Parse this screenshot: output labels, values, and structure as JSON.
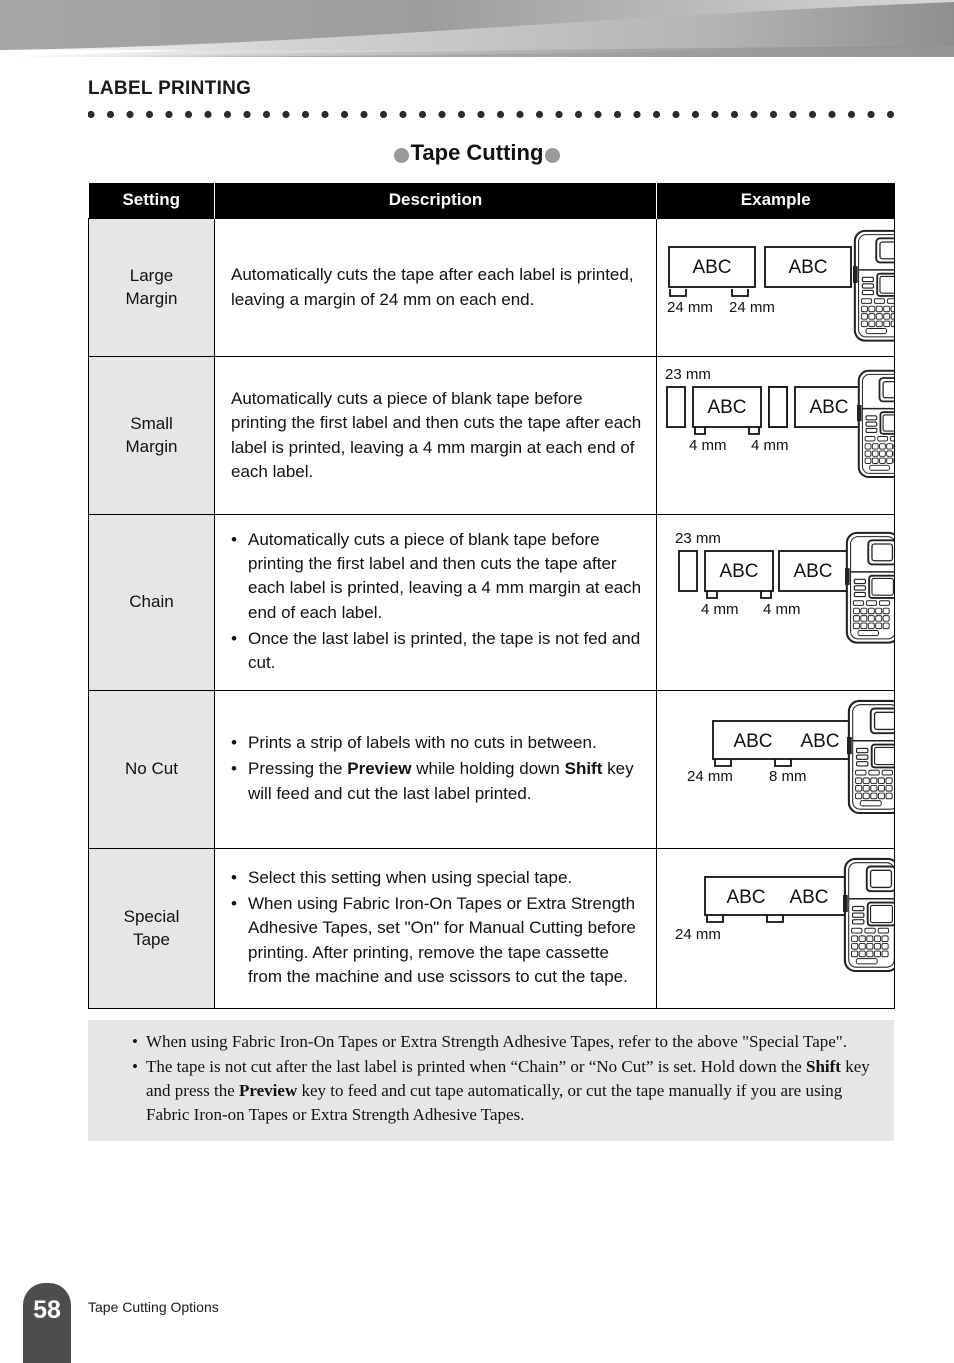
{
  "header": {
    "chapter": "LABEL PRINTING",
    "section_title": "Tape Cutting"
  },
  "table": {
    "columns": [
      "Setting",
      "Description",
      "Example"
    ],
    "rows": [
      {
        "setting": "Large\nMargin",
        "description_type": "paragraph",
        "description": "Automatically cuts the tape after each label is printed, leaving a margin of 24 mm on each end.",
        "example": {
          "style": "two-separate-labels",
          "labels": [
            "ABC",
            "ABC"
          ],
          "measures": [
            "24 mm",
            "24 mm"
          ],
          "lead_measure": ""
        }
      },
      {
        "setting": "Small\nMargin",
        "description_type": "paragraph",
        "description": "Automatically cuts a piece of blank tape before printing the first label and then cuts the tape after each label is printed, leaving a 4 mm margin at each end of each label.",
        "example": {
          "style": "blank-plus-two-labels",
          "labels": [
            "ABC",
            "ABC"
          ],
          "measures": [
            "4 mm",
            "4 mm"
          ],
          "lead_measure": "23 mm"
        }
      },
      {
        "setting": "Chain",
        "description_type": "bullets",
        "bullets": [
          "Automatically cuts a piece of blank tape before printing the first label and then cuts the tape after each label is printed, leaving a 4 mm margin at each end of each label.",
          "Once the last label is printed, the tape is not fed and cut."
        ],
        "example": {
          "style": "chain",
          "labels": [
            "ABC",
            "ABC"
          ],
          "measures": [
            "4 mm",
            "4 mm"
          ],
          "lead_measure": "23 mm"
        }
      },
      {
        "setting": "No Cut",
        "description_type": "bullets-rich",
        "bullets_rich": [
          [
            {
              "t": "Prints a strip of labels with no cuts in between."
            }
          ],
          [
            {
              "t": "Pressing the "
            },
            {
              "t": "Preview",
              "bold": true
            },
            {
              "t": " while holding down "
            },
            {
              "t": "Shift",
              "bold": true
            },
            {
              "t": " key will feed and cut the last label printed."
            }
          ]
        ],
        "example": {
          "style": "continuous-strip",
          "labels": [
            "ABC",
            "ABC"
          ],
          "measures": [
            "24 mm",
            "8 mm"
          ],
          "lead_measure": ""
        }
      },
      {
        "setting": "Special\nTape",
        "description_type": "bullets",
        "bullets": [
          "Select this setting when using special tape.",
          "When using Fabric Iron-On Tapes or Extra Strength Adhesive Tapes, set \"On\" for Manual Cutting before printing. After printing, remove the tape cassette from the machine and use scissors to cut the tape."
        ],
        "example": {
          "style": "continuous-strip-special",
          "labels": [
            "ABC",
            "ABC"
          ],
          "measures": [
            "24 mm"
          ],
          "lead_measure": ""
        }
      }
    ]
  },
  "note": {
    "icon": "lightbulb-icon",
    "items_rich": [
      [
        {
          "t": "When using Fabric Iron-On Tapes or Extra Strength Adhesive Tapes, refer to the above \"Special Tape\"."
        }
      ],
      [
        {
          "t": "The tape is not cut after the last label is printed when “Chain” or “No Cut” is set. Hold down the "
        },
        {
          "t": "Shift",
          "bold": true
        },
        {
          "t": " key and press the "
        },
        {
          "t": "Preview",
          "bold": true
        },
        {
          "t": " key to feed and cut tape automatically, or cut the tape manually if you are using Fabric Iron-on Tapes or Extra Strength Adhesive Tapes."
        }
      ]
    ]
  },
  "footer": {
    "page_number": "58",
    "footer_label": "Tape Cutting Options"
  },
  "colors": {
    "header_bar": "#000000",
    "setting_cell_bg": "#e6e6e6",
    "note_bg": "#e6e6e6",
    "page_badge": "#4d4d4d",
    "title_dot": "#9a9a9a"
  }
}
